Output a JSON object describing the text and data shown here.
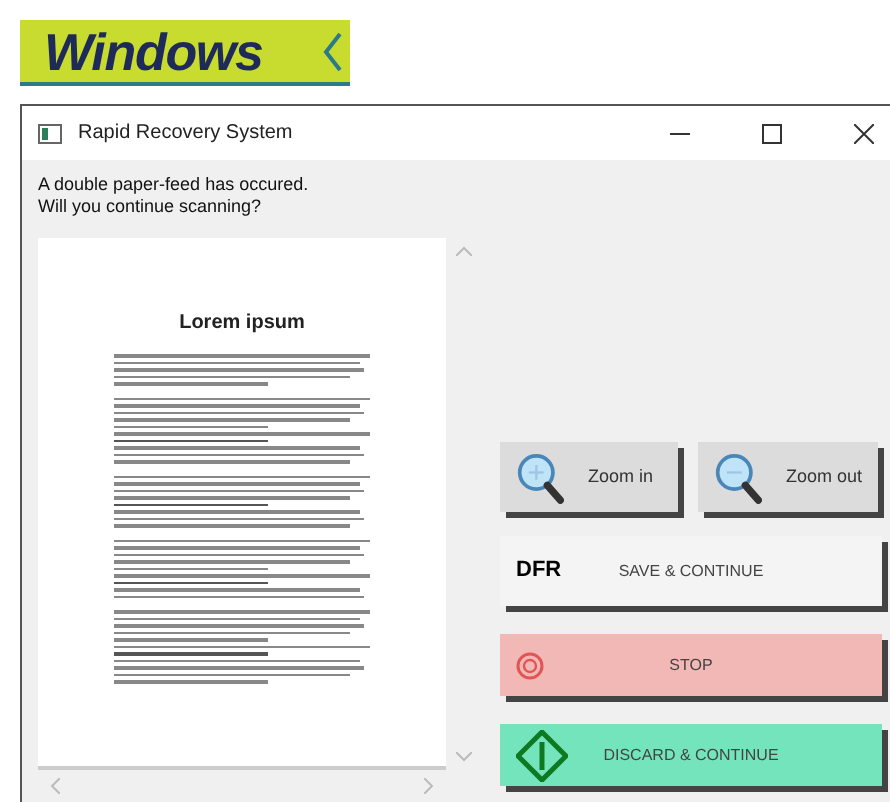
{
  "logo": {
    "text": "Windows"
  },
  "window": {
    "title": "Rapid Recovery System"
  },
  "message": [
    "A double paper-feed has occured.",
    "Will you continue scanning?"
  ],
  "preview": {
    "heading": "Lorem ipsum"
  },
  "zoom_buttons": [
    {
      "label": "Zoom in",
      "kind": "zoom-in"
    },
    {
      "label": "Zoom out",
      "kind": "zoom-out"
    }
  ],
  "action_buttons": [
    {
      "label": "SAVE & CONTINUE",
      "kind": "save",
      "badge": "DFR"
    },
    {
      "label": "STOP",
      "kind": "stop"
    },
    {
      "label": "DISCARD & CONTINUE",
      "kind": "discard"
    }
  ]
}
